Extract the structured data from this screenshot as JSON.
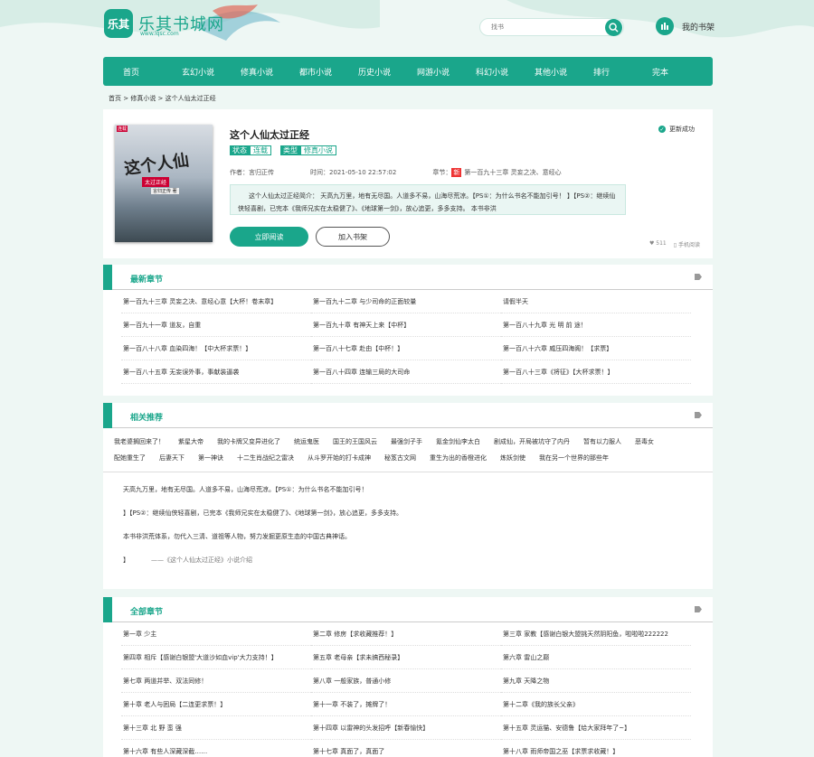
{
  "site": {
    "name": "乐其书城网",
    "domain": "www.lqsc.com",
    "logo_text": "乐其"
  },
  "search": {
    "placeholder": "找书"
  },
  "shelf_label": "我的书架",
  "nav": [
    "首页",
    "玄幻小说",
    "修真小说",
    "都市小说",
    "历史小说",
    "网游小说",
    "科幻小说",
    "其他小说",
    "排行",
    "完本"
  ],
  "breadcrumb": "首页 > 修真小说 > 这个人仙太过正经",
  "book": {
    "title": "这个人仙太过正经",
    "status_key": "状态",
    "status_val": "连载",
    "cat_key": "类型",
    "cat_val": "修真小说",
    "author": "作者：言归正传",
    "time": "时间：2021-05-10 22:57:02",
    "latest_key": "章节：",
    "new_badge": "新",
    "latest": "第一百九十三章 灵妄之决、意经心",
    "intro": "这个人仙太过正经简介： 天高九万里，地有无尽国。人道多不易，山海尽荒凉。【PS①：为什么书名不能加引号！ 】【PS②：继续仙侠轻喜剧，已完本《我师兄实在太稳健了》、《地球第一剑》，放心追更，多多支持。 本书非洪",
    "read_btn": "立即阅读",
    "shelf_btn": "加入书架",
    "update_ok": "更新成功",
    "likes": "511",
    "mobile": "手机阅读",
    "cover_title": "这个人仙",
    "cover_sub": "太过正经",
    "cover_author": "言归正传 著",
    "cover_tag": "连载"
  },
  "latest_section": {
    "title": "最新章节",
    "items": [
      "第一百九十三章 灵妄之决、意经心意【大杯！卷末章】",
      "第一百九十二章 与少司命的正面较量",
      "请假半天",
      "第一百九十一章 道友，自重",
      "第一百九十章 有神天上来【中杯】",
      "第一百八十九章 光 明 前 途！",
      "第一百八十八章 血染四海！【中大杯求票！】",
      "第一百八十七章 赴由【中杯！】",
      "第一百八十六章 威压四海阁！【求票】",
      "第一百八十五章 无妄误外事，事献装逼袭",
      "第一百八十四章 连输三局的大司命",
      "第一百八十三章《将征》【大杯求票！】"
    ]
  },
  "recs_section": {
    "title": "相关推荐",
    "items": [
      "我老婆搁回来了！",
      "紫星大帝",
      "我的卡牌又变异进化了",
      "统运鬼医",
      "国王的王国风云",
      "最强剑子手",
      "氪金剑仙李太白",
      "剧成仙，开局被坑守了内丹",
      "暂有以力服人",
      "恶毒女",
      "配她重生了",
      "后妻天下",
      "第一神诀",
      "十二生肖战纪之雷决",
      "从斗罗开始的打卡成神",
      "秘笈古文网",
      "重生为出的香橙进化",
      "炼妖剑使",
      "我在另一个世界的那些年"
    ]
  },
  "desc_section": {
    "p1": "天高九万里，地有无尽国。人道多不易，山海尽荒凉。【PS①：为什么书名不能加引号！",
    "p2": "】【PS②：继续仙侠轻喜剧，已完本《我师兄实在太稳健了》、《地球第一剑》，放心追更，多多支持。",
    "p3": "本书非洪荒体系，勿代入三清、道祖等人物，努力发掘更原生态的中国古典神话。",
    "p4a": "】",
    "p4b": "——《这个人仙太过正经》小说介绍"
  },
  "all_section": {
    "title": "全部章节",
    "items": [
      "第一章 少主",
      "第二章 修房【求收藏推荐！】",
      "第三章 家教【感谢白银大盟挑天然阴阳鱼，啦啦啦222222",
      "第四章 相斥【感谢白银盟'大道沙如血vip'大力支持！】",
      "第五章 老母亲【求未搞西秘录】",
      "第六章 雷山之巅",
      "第七章 两道并举、双法同修！",
      "第八章 一般家族，普通小修",
      "第九章 天降之物",
      "第十章 老人与困局【二连更求票！】",
      "第十一章 不装了，摊牌了！",
      "第十二章《我的族长父亲》",
      "第十三章 北 野 蛮 强",
      "第十四章 以雷神的头发招呼【新春愉快】",
      "第十五章 灵运猫、安德鲁【给大家拜年了~】",
      "第十六章 有些人深藏深截……",
      "第十七章 真面了，真面了",
      "第十八章 雨师帝国之巫【求票求收藏！】"
    ]
  },
  "colors": {
    "accent": "#1aa68b",
    "bg": "#eef7f4"
  }
}
